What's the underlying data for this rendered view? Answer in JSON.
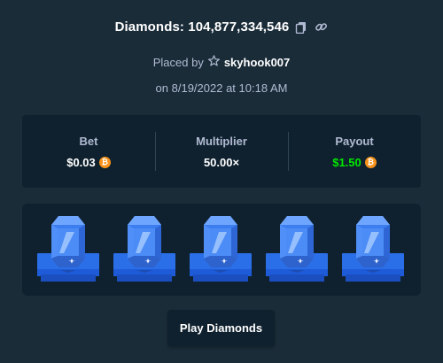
{
  "header": {
    "title": "Diamonds: 104,877,334,546",
    "copy_icon": "copy-icon",
    "link_icon": "link-icon"
  },
  "placed": {
    "prefix": "Placed by",
    "star_icon": "star-icon",
    "username": "skyhook007"
  },
  "date": "on 8/19/2022 at 10:18 AM",
  "stats": {
    "bet": {
      "label": "Bet",
      "value": "$0.03",
      "currency_icon": "bitcoin-icon"
    },
    "multiplier": {
      "label": "Multiplier",
      "value": "50.00×"
    },
    "payout": {
      "label": "Payout",
      "value": "$1.50",
      "currency_icon": "bitcoin-icon",
      "color": "#00e701"
    }
  },
  "board": {
    "gems": [
      "blue",
      "blue",
      "blue",
      "blue",
      "blue"
    ],
    "gem_color": "#3b82f6",
    "platform_color": "#1e5bd8"
  },
  "play_button": {
    "label": "Play Diamonds"
  },
  "colors": {
    "background": "#1a2c38",
    "panel": "#0f212e",
    "muted_text": "#b1bad3",
    "accent_coin": "#f7931a"
  }
}
